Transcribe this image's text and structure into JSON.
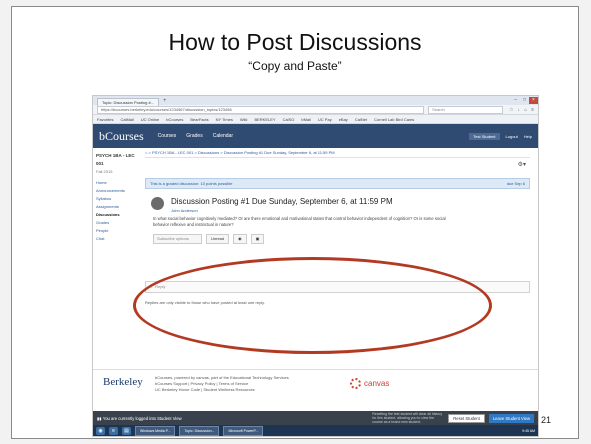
{
  "slide": {
    "title": "How to Post Discussions",
    "subtitle": "“Copy and Paste”",
    "number": "21"
  },
  "browser": {
    "tab_label": "Topic: Discussion Posting #...",
    "new_tab": "+",
    "url": "https://bcourses.berkeley.edu/courses/1234567/discussion_topics/123456",
    "search_placeholder": "Search",
    "bookmarks": [
      "Favorites",
      "CalMail",
      "UC Online",
      "bCourses",
      "BearFacts",
      "NY Times",
      "Wiki",
      "BERKELEY",
      "CalSO",
      "bMail",
      "UC Pay",
      "eBay",
      "CalNet",
      "Cornell Lab Bird Cams"
    ]
  },
  "canvas": {
    "brand": "bCourses",
    "global_nav": [
      "Courses",
      "Grades",
      "Calendar"
    ],
    "user_name": "Test Student",
    "header_links": [
      "Logout",
      "Help"
    ]
  },
  "course_nav": {
    "course_code": "PSYCH 1BA - LEC 001",
    "term": "Fall 2015",
    "items": [
      "Home",
      "Announcements",
      "Syllabus",
      "Assignments",
      "Discussions",
      "Grades",
      "People",
      "Chat"
    ],
    "active_index": 4
  },
  "breadcrumb": "⌂ > PSYCH 1BA - LEC 001 > Discussions > Discussion Posting #1 Due Sunday, September 6, at 11:59 PM",
  "notice": {
    "text": "This is a graded discussion: 10 points possible",
    "due": "due Sep 6"
  },
  "post": {
    "title": "Discussion Posting #1 Due Sunday, September 6, at 11:59 PM",
    "author": "John Anderson",
    "body": "In what social behavior cognitively mediated? Or are there emotional and motivational states that control behavior independent of cognition? Or is some social behavior reflexive and instinctual in nature?",
    "subscribe_placeholder": "Subscribe options",
    "unread_label": "Unread",
    "icon_1": "◉",
    "icon_2": "▣"
  },
  "reply": {
    "placeholder": "← Reply",
    "note": "Replies are only visible to those who have posted at least one reply."
  },
  "footer": {
    "berkeley": "Berkeley",
    "line1": "bCourses, powered by canvas, part of the Educational Technology Services",
    "line2": "bCourses Support | Privacy Policy | Terms of Service",
    "line3": "UC Berkeley Honor Code | Student Wellness Resources",
    "canvas_logo": "canvas"
  },
  "student_view": {
    "text": "You are currently logged into Student View",
    "note": "Resetting the test student will clear all history for this student, allowing you to view the course as a brand new student.",
    "reset_label": "Reset Student",
    "leave_label": "Leave Student View"
  },
  "taskbar": {
    "tasks": [
      "Windows Media P...",
      "Topic: Discussion...",
      "Microsoft PowerP..."
    ],
    "clock": "9:45 AM"
  },
  "colors": {
    "canvas_header": "#2f4b72",
    "annotation_ellipse": "#b33a22",
    "canvas_logo": "#d4402b"
  }
}
